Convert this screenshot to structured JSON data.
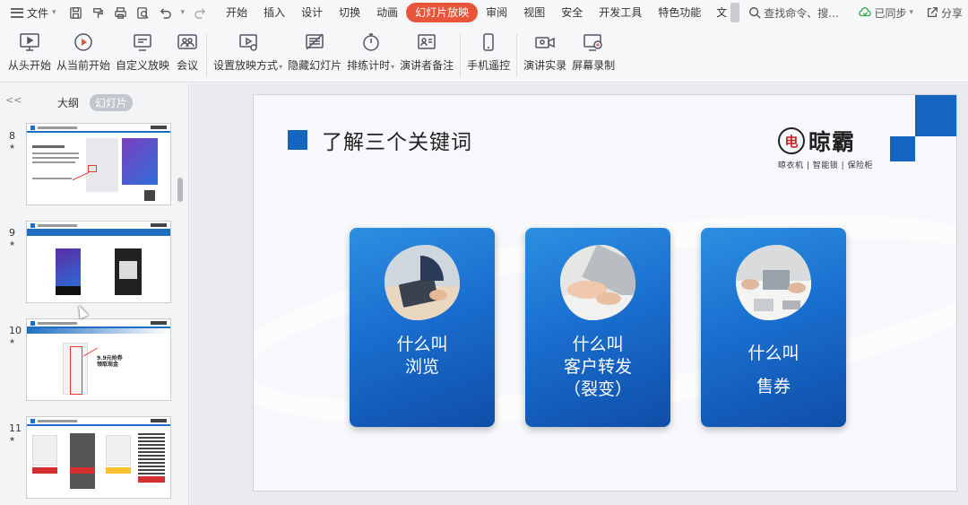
{
  "menubar": {
    "file_label": "文件",
    "tabs": [
      "开始",
      "插入",
      "设计",
      "切换",
      "动画",
      "幻灯片放映",
      "审阅",
      "视图",
      "安全",
      "开发工具",
      "特色功能",
      "文"
    ],
    "active_tab": "幻灯片放映",
    "search_label": "查找命令、搜...",
    "sync_label": "已同步",
    "share_label": "分享"
  },
  "ribbon": {
    "buttons": [
      {
        "label": "从头开始",
        "icon": "slideshow-from-start-icon"
      },
      {
        "label": "从当前开始",
        "icon": "play-circle-icon"
      },
      {
        "label": "自定义放映",
        "icon": "custom-show-icon"
      },
      {
        "label": "会议",
        "icon": "meeting-icon"
      },
      {
        "label": "设置放映方式",
        "icon": "setup-show-icon"
      },
      {
        "label": "隐藏幻灯片",
        "icon": "hide-slide-icon"
      },
      {
        "label": "排练计时",
        "icon": "stopwatch-icon"
      },
      {
        "label": "演讲者备注",
        "icon": "speaker-notes-icon"
      },
      {
        "label": "手机遥控",
        "icon": "phone-remote-icon"
      },
      {
        "label": "演讲实录",
        "icon": "camera-record-icon"
      },
      {
        "label": "屏幕录制",
        "icon": "screen-record-icon"
      }
    ]
  },
  "left_panel": {
    "tab_outline": "大纲",
    "tab_slides": "幻灯片",
    "collapse_glyph": "<<",
    "slides": [
      {
        "number": "8",
        "star": "★"
      },
      {
        "number": "9",
        "star": "★"
      },
      {
        "number": "10",
        "star": "★"
      },
      {
        "number": "11",
        "star": "★"
      }
    ],
    "thumb10_text_a": "9.9元抢券",
    "thumb10_text_b": "领取现金"
  },
  "slide": {
    "title": "了解三个关键词",
    "brand": {
      "mark": "电",
      "name": "晾霸",
      "tagline": "晾衣机 | 智能锁 | 保险柜"
    },
    "cards": [
      {
        "line1": "什么叫",
        "line2": "浏览",
        "line3": ""
      },
      {
        "line1": "什么叫",
        "line2": "客户转发",
        "line3": "（裂变）"
      },
      {
        "line1": "什么叫",
        "line2": "售券",
        "line3": ""
      }
    ]
  },
  "colors": {
    "accent": "#e8553a",
    "slide_blue": "#1565c0",
    "brand_red": "#c62828"
  }
}
